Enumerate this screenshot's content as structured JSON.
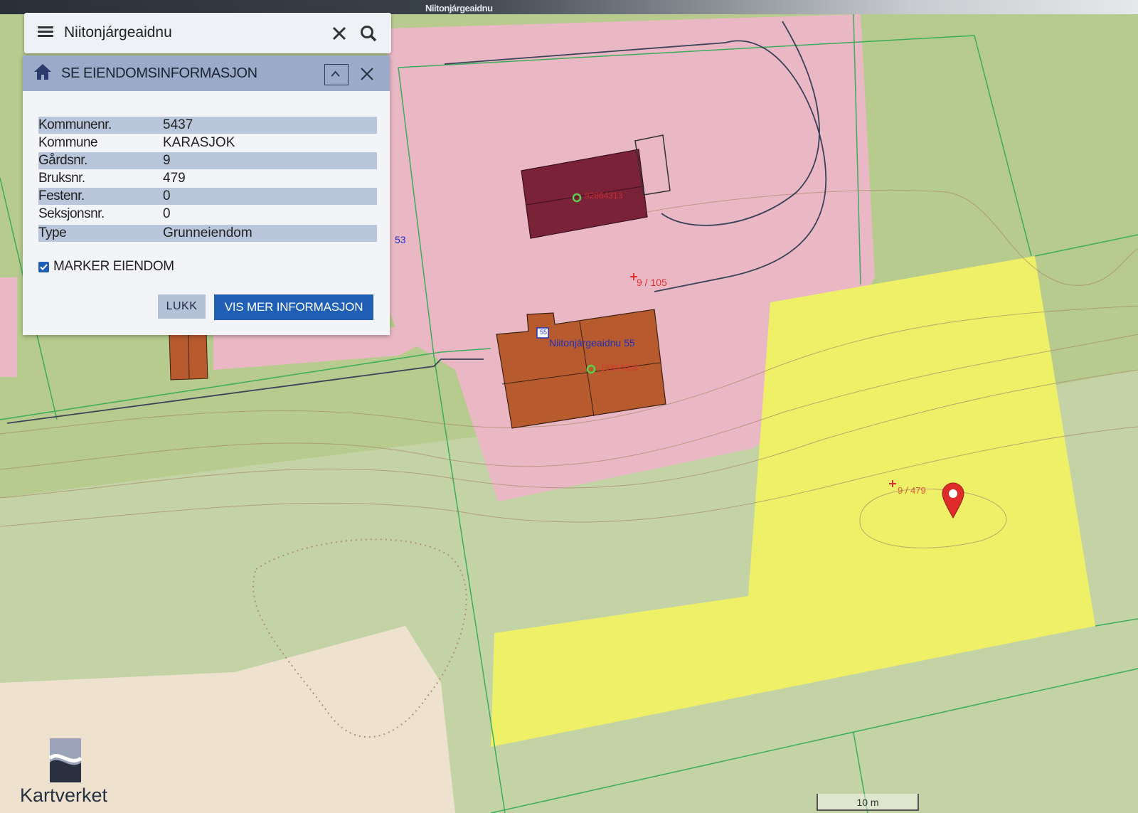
{
  "app": {
    "top_title": "Niitonjárgeaidnu",
    "logo_text": "Kartverket",
    "scale_label": "10 m"
  },
  "search": {
    "value": "Niitonjárgeaidnu",
    "menu_icon": "hamburger-menu-icon",
    "clear_icon": "close-icon",
    "search_icon": "search-icon"
  },
  "panel": {
    "title": "SE EIENDOMSINFORMASJON",
    "rows": [
      {
        "label": "Kommunenr.",
        "value": "5437"
      },
      {
        "label": "Kommune",
        "value": "KARASJOK"
      },
      {
        "label": "Gårdsnr.",
        "value": "9"
      },
      {
        "label": "Bruksnr.",
        "value": "479"
      },
      {
        "label": "Festenr.",
        "value": "0"
      },
      {
        "label": "Seksjonsnr.",
        "value": "0"
      },
      {
        "label": "Type",
        "value": "Grunneiendom"
      }
    ],
    "checkbox_label": "MARKER EIENDOM",
    "checkbox_checked": true,
    "close_button": "LUKK",
    "more_button": "VIS MER INFORMASJON"
  },
  "map": {
    "labels": {
      "parcel_105": "9 / 105",
      "parcel_479": "9 / 479",
      "address": "Niitonjárgeaidnu 55",
      "building_id_1": "92864313",
      "building_id_2": "19804938",
      "number_53": "53",
      "address_marker": "55"
    },
    "colors": {
      "green": "#b7cb8e",
      "pink": "#eab8c4",
      "yellow": "#eef068",
      "building_orange": "#b75b2e",
      "building_maroon": "#7a2238",
      "marker_red": "#e02b2b"
    }
  }
}
